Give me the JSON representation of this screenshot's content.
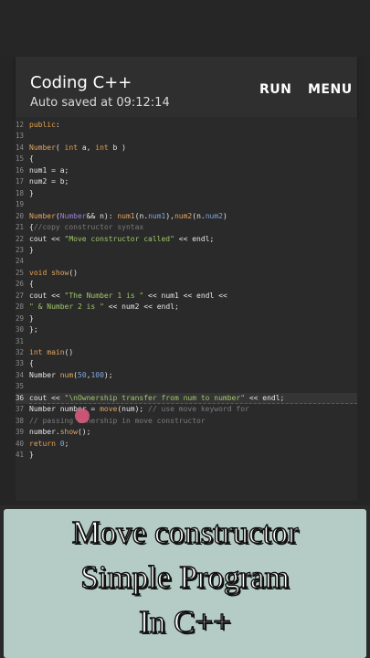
{
  "app": {
    "title": "Coding C++",
    "autosave": "Auto saved at 09:12:14",
    "run_label": "RUN",
    "menu_label": "MENU"
  },
  "editor": {
    "current_line": "36",
    "lines": [
      {
        "n": "12",
        "html": "<span class=\"kw\">public</span>:"
      },
      {
        "n": "13",
        "html": ""
      },
      {
        "n": "14",
        "html": "<span class=\"fn\">Number</span>( <span class=\"kw\">int</span> a, <span class=\"kw\">int</span> b )"
      },
      {
        "n": "15",
        "html": "{"
      },
      {
        "n": "16",
        "html": "num1 = a;"
      },
      {
        "n": "17",
        "html": "num2 = b;"
      },
      {
        "n": "18",
        "html": "}"
      },
      {
        "n": "19",
        "html": ""
      },
      {
        "n": "20",
        "html": "<span class=\"fn\">Number</span>(<span class=\"ty\">Number</span>&& n): <span class=\"fn\">num1</span>(n.<span class=\"nm\">num1</span>),<span class=\"fn\">num2</span>(n.<span class=\"nm\">num2</span>)"
      },
      {
        "n": "21",
        "html": "{<span class=\"cm\">//copy constructor syntax</span>"
      },
      {
        "n": "22",
        "html": "cout << <span class=\"str\">\"Move constructor called\"</span> << endl;"
      },
      {
        "n": "23",
        "html": "}"
      },
      {
        "n": "24",
        "html": ""
      },
      {
        "n": "25",
        "html": "<span class=\"kw\">void</span> <span class=\"fn\">show</span>()"
      },
      {
        "n": "26",
        "html": "{"
      },
      {
        "n": "27",
        "html": "cout << <span class=\"str\">\"The Number 1 is \"</span> << num1 << endl <<"
      },
      {
        "n": "28",
        "html": "<span class=\"str\">\" & Number 2 is \"</span> << num2 << endl;"
      },
      {
        "n": "29",
        "html": "}"
      },
      {
        "n": "30",
        "html": "};"
      },
      {
        "n": "31",
        "html": ""
      },
      {
        "n": "32",
        "html": "<span class=\"kw\">int</span> <span class=\"fn\">main</span>()"
      },
      {
        "n": "33",
        "html": "{"
      },
      {
        "n": "34",
        "html": "Number <span class=\"fn\">num</span>(<span class=\"nm\">50</span>,<span class=\"nm\">100</span>);"
      },
      {
        "n": "35",
        "html": ""
      },
      {
        "n": "36",
        "html": "cout << <span class=\"str\">\"\\nOwnership transfer from num to number\"</span> << endl;"
      },
      {
        "n": "37",
        "html": "Number number = <span class=\"fn\">move</span>(num); <span class=\"cm\">// use move keyword for</span>"
      },
      {
        "n": "38",
        "html": "<span class=\"cm\">// passing ownership in move constructor</span>"
      },
      {
        "n": "39",
        "html": "number.<span class=\"fn\">show</span>();"
      },
      {
        "n": "40",
        "html": "<span class=\"kw\">return</span> <span class=\"nm\">0</span>;"
      },
      {
        "n": "41",
        "html": "}"
      }
    ]
  },
  "banner": {
    "line1": "Move constructor",
    "line2": "Simple Program",
    "line3": "In C++"
  },
  "colors": {
    "background": "#252525",
    "appbar": "#2f2f2f",
    "editor": "#2a2a2a",
    "banner_card": "#b4ccc5",
    "keyword": "#e7a24b",
    "string": "#9fc76a",
    "number": "#7fa8e0",
    "comment": "#7b7b7b"
  }
}
